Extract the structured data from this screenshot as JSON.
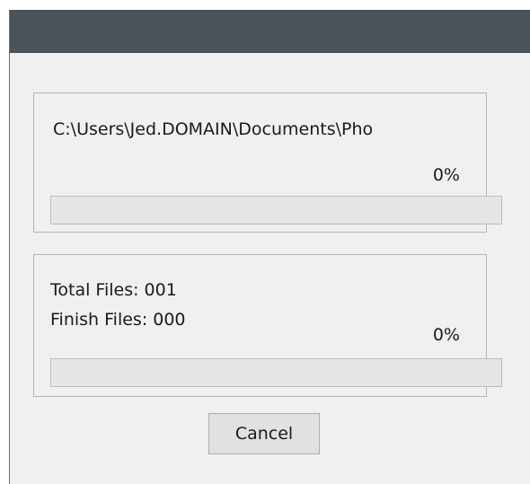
{
  "current_file": {
    "path": "C:\\Users\\Jed.DOMAIN\\Documents\\Pho",
    "percent_label": "0%",
    "progress": 0
  },
  "totals": {
    "total_files": "Total Files: 001",
    "finish_files": "Finish Files: 000",
    "percent_label": "0%",
    "progress": 0
  },
  "buttons": {
    "cancel_label": "Cancel"
  },
  "colors": {
    "titlebar": "#4b5258",
    "window_bg": "#f0f0f0",
    "progress_fill": "#06b025"
  }
}
